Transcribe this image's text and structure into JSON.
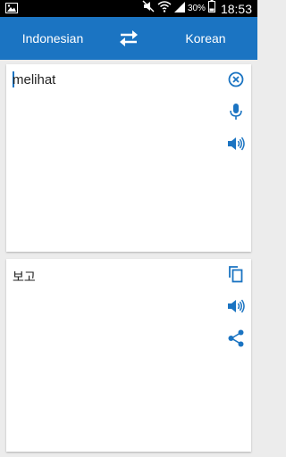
{
  "status_bar": {
    "battery_percent": "30%",
    "time": "18:53",
    "icons": [
      "image-notification-icon",
      "mute-icon",
      "wifi-icon",
      "signal-icon",
      "battery-icon"
    ]
  },
  "toolbar": {
    "source_language": "Indonesian",
    "target_language": "Korean",
    "swap_icon": "swap-arrows-icon"
  },
  "source_panel": {
    "input_text": "melihat",
    "icons": [
      "clear-icon",
      "microphone-icon",
      "speaker-icon"
    ]
  },
  "target_panel": {
    "output_text": "보고",
    "icons": [
      "copy-icon",
      "speaker-icon",
      "share-icon"
    ]
  },
  "colors": {
    "app_bar": "#1b74c2",
    "icon_blue": "#1b74c2",
    "background": "#ececec",
    "status_bar": "#000000"
  }
}
